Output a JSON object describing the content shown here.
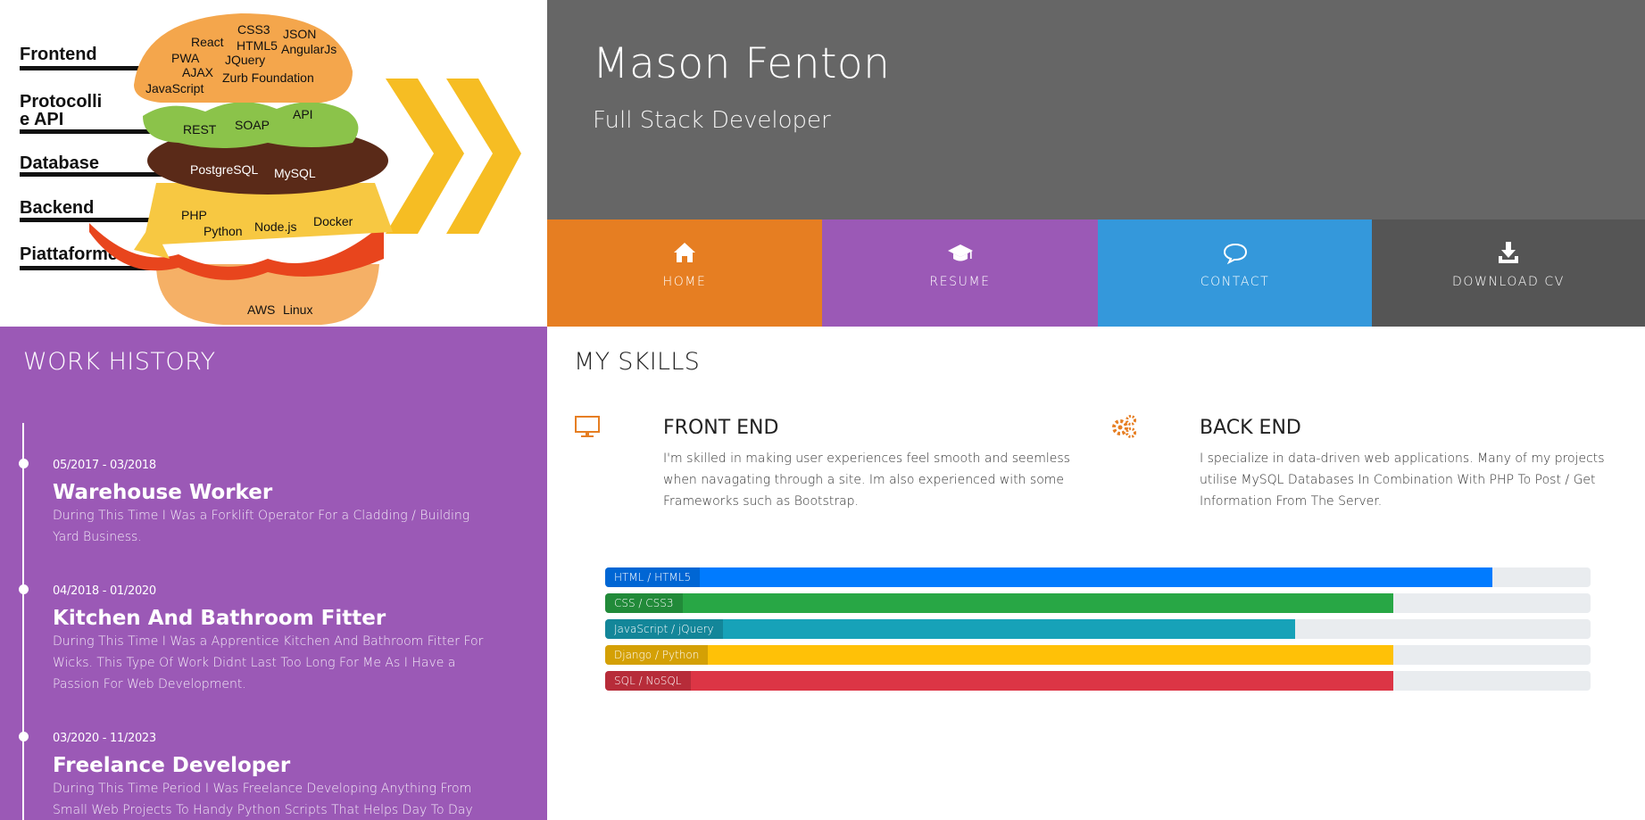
{
  "hero": {
    "layers": [
      "Frontend",
      "Protocolli e API",
      "Database",
      "Backend",
      "Piattaforme"
    ],
    "frontend_tags": [
      "React",
      "CSS3",
      "HTML5",
      "JSON",
      "AngularJs",
      "PWA",
      "AJAX",
      "JQuery",
      "JavaScript",
      "Zurb Foundation"
    ],
    "api_tags": [
      "REST",
      "SOAP",
      "API"
    ],
    "db_tags": [
      "PostgreSQL",
      "MySQL"
    ],
    "backend_tags": [
      "PHP",
      "Python",
      "Node.js",
      "Docker"
    ],
    "platform_tags": [
      "AWS",
      "Linux"
    ]
  },
  "header": {
    "name": "Mason Fenton",
    "role": "Full Stack Developer"
  },
  "nav": {
    "items": [
      {
        "label": "HOME",
        "icon": "home-icon",
        "color": "#e67e22"
      },
      {
        "label": "RESUME",
        "icon": "graduation-cap-icon",
        "color": "#9b59b6"
      },
      {
        "label": "CONTACT",
        "icon": "chat-bubble-icon",
        "color": "#3498db"
      },
      {
        "label": "DOWNLOAD CV",
        "icon": "download-icon",
        "color": "#555555"
      }
    ]
  },
  "work": {
    "title": "WORK HISTORY",
    "jobs": [
      {
        "date": "05/2017 - 03/2018",
        "title": "Warehouse Worker",
        "desc": "During This Time I Was a Forklift Operator For a Cladding / Building Yard Business."
      },
      {
        "date": "04/2018 - 01/2020",
        "title": "Kitchen And Bathroom Fitter",
        "desc": "During This Time I Was a Apprentice Kitchen And Bathroom Fitter For Wicks. This Type Of Work Didnt Last Too Long For Me As I Have a Passion For Web Development."
      },
      {
        "date": "03/2020 - 11/2023",
        "title": "Freelance Developer",
        "desc": "During This Time Period I Was Freelance Developing Anything From Small Web Projects To Handy Python Scripts That Helps Day To Day"
      }
    ]
  },
  "skills": {
    "title": "MY SKILLS",
    "front": {
      "icon": "monitor-icon",
      "heading": "FRONT END",
      "desc": "I'm skilled in making user experiences feel smooth and seemless when navagating through a site. Im also experienced with some Frameworks such as Bootstrap."
    },
    "back": {
      "icon": "gears-icon",
      "heading": "BACK END",
      "desc": "I specialize in data-driven web applications. Many of my projects utilise MySQL Databases In Combination With PHP To Post / Get Information From The Server."
    },
    "bars": [
      {
        "label": "HTML / HTML5",
        "percent": 90,
        "color": "#007bff"
      },
      {
        "label": "CSS / CSS3",
        "percent": 80,
        "color": "#28a745"
      },
      {
        "label": "JavaScript / jQuery",
        "percent": 70,
        "color": "#17a2b8"
      },
      {
        "label": "Django / Python",
        "percent": 80,
        "color": "#ffc107"
      },
      {
        "label": "SQL / NoSQL",
        "percent": 80,
        "color": "#dc3545"
      }
    ]
  }
}
